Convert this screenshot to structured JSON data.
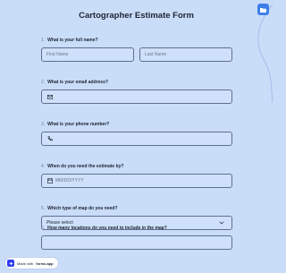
{
  "form": {
    "title": "Cartographer Estimate Form",
    "questions": [
      {
        "number": "1.",
        "label": "What is your full name?",
        "first_placeholder": "First Name",
        "last_placeholder": "Last Name"
      },
      {
        "number": "2.",
        "label": "What is your email address?",
        "icon": "envelope-icon"
      },
      {
        "number": "3.",
        "label": "What is your phone number?",
        "icon": "phone-icon"
      },
      {
        "number": "4.",
        "label": "When do you need the estimate by?",
        "icon": "calendar-icon",
        "placeholder": "MM/DD/YYYY"
      },
      {
        "number": "5.",
        "label": "Which type of map do you need?",
        "selected": "Please select"
      },
      {
        "number": "6.",
        "label": "How many locations do you need to include in the map?"
      }
    ]
  },
  "badge": {
    "prefix": "Made with",
    "brand": "forms.app"
  },
  "colors": {
    "background": "#c9dcf8",
    "accent": "#3f7ee8",
    "border": "#5f6f8f"
  }
}
